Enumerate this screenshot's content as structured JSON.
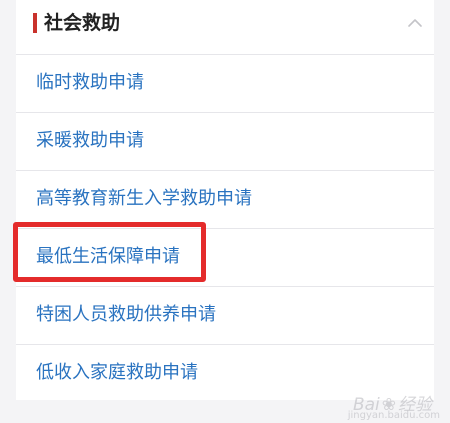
{
  "section": {
    "title": "社会救助",
    "collapse_icon": "chevron-up-icon"
  },
  "items": [
    {
      "label": "临时救助申请"
    },
    {
      "label": "采暖救助申请"
    },
    {
      "label": "高等教育新生入学救助申请"
    },
    {
      "label": "最低生活保障申请",
      "highlighted": true
    },
    {
      "label": "特困人员救助供养申请"
    },
    {
      "label": "低收入家庭救助申请"
    }
  ],
  "watermark": {
    "text": "Bai",
    "suffix": "经验",
    "sub": "jingyan.baidu.com"
  },
  "colors": {
    "accent_bar": "#c9322c",
    "link": "#2a73c0",
    "highlight": "#e42b2b",
    "background": "#f4f4f6"
  }
}
